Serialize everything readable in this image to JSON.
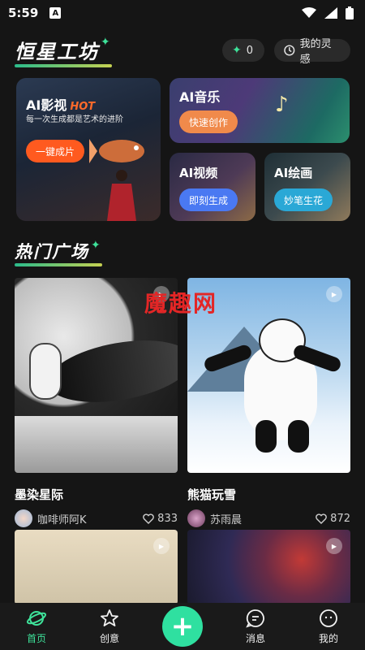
{
  "status_bar": {
    "time": "5:59",
    "badge": "A"
  },
  "header": {
    "brand": "恒星工坊",
    "credits": "0",
    "inspiration_label": "我的灵感"
  },
  "feature_cards": {
    "ai_video_big": {
      "title": "AI影视",
      "hot_tag": "HOT",
      "subtitle": "每一次生成都是艺术的进阶",
      "cta": "一键成片"
    },
    "ai_music": {
      "title": "AI音乐",
      "cta": "快速创作"
    },
    "ai_video": {
      "title": "AI视频",
      "cta": "即刻生成"
    },
    "ai_paint": {
      "title": "AI绘画",
      "cta": "妙笔生花"
    }
  },
  "section": {
    "title": "热门广场"
  },
  "watermark": "魔趣网",
  "feed": [
    {
      "title": "墨染星际",
      "author": "咖啡师阿K",
      "likes": "833"
    },
    {
      "title": "熊猫玩雪",
      "author": "苏雨晨",
      "likes": "872"
    }
  ],
  "bottom_nav": {
    "home": "首页",
    "create": "创意",
    "messages": "消息",
    "mine": "我的"
  },
  "colors": {
    "accent": "#3ee29a",
    "orange_cta": "#ff5a1f",
    "background": "#151515"
  }
}
